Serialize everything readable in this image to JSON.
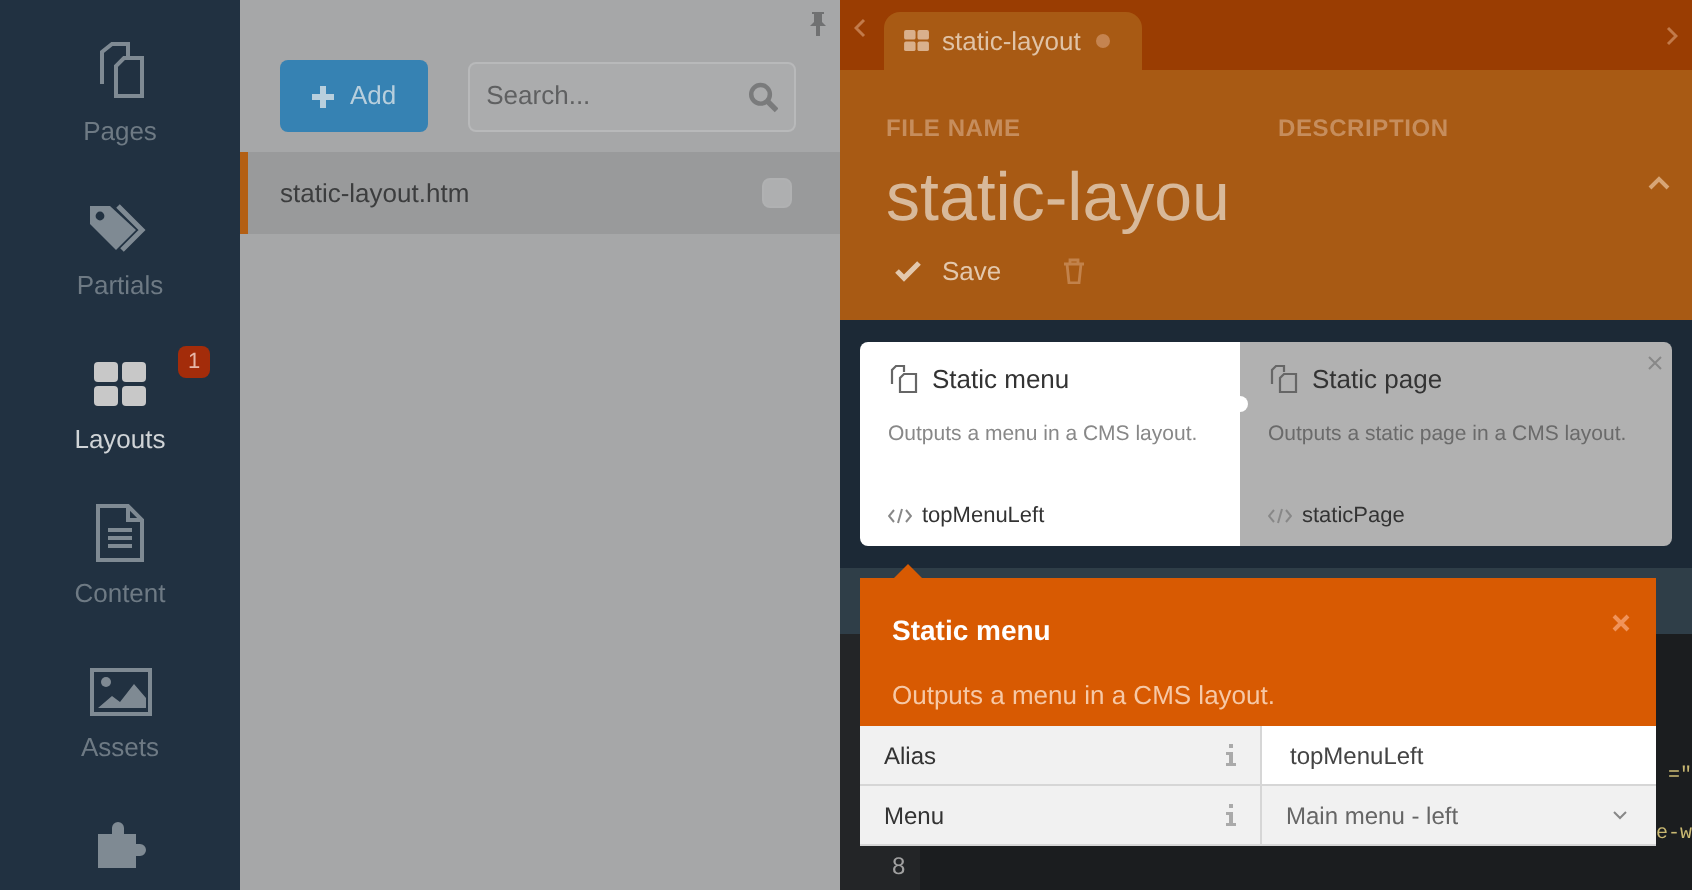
{
  "sidebar": {
    "items": [
      {
        "kind": "pages",
        "label": "Pages",
        "selected": false
      },
      {
        "kind": "partials",
        "label": "Partials",
        "selected": false
      },
      {
        "kind": "layouts",
        "label": "Layouts",
        "selected": true,
        "badge": "1"
      },
      {
        "kind": "content",
        "label": "Content",
        "selected": false
      },
      {
        "kind": "assets",
        "label": "Assets",
        "selected": false
      },
      {
        "kind": "plugin",
        "selected": false
      }
    ]
  },
  "list_panel": {
    "add_button": "Add",
    "search": {
      "placeholder": "Search..."
    },
    "files": [
      {
        "name": "static-layout.htm",
        "selected": true,
        "checked": false
      }
    ]
  },
  "editor": {
    "tab": {
      "title": "static-layout",
      "modified": true
    },
    "form": {
      "file_name_label": "FILE NAME",
      "description_label": "DESCRIPTION",
      "file_name": "static-layou",
      "save_button": "Save"
    },
    "components": [
      {
        "title": "Static menu",
        "description": "Outputs a menu in a CMS layout.",
        "alias": "topMenuLeft",
        "selected": true
      },
      {
        "title": "Static page",
        "description": "Outputs a static page in a CMS layout.",
        "alias": "staticPage",
        "selected": false
      }
    ],
    "code": {
      "line_number": "8",
      "fragments": [
        "=\"",
        "e-w"
      ]
    },
    "popup": {
      "title": "Static menu",
      "description": "Outputs a menu in a CMS layout.",
      "properties": [
        {
          "kind": "text",
          "label": "Alias",
          "value": "topMenuLeft"
        },
        {
          "kind": "dropdown",
          "label": "Menu",
          "value": "Main menu - left"
        }
      ]
    }
  }
}
